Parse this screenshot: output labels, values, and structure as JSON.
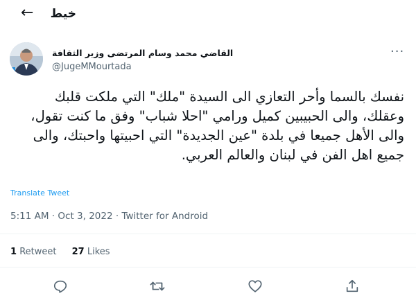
{
  "header": {
    "back_icon": "arrow-left-icon",
    "title": "خيط"
  },
  "tweet": {
    "author_name": "القاضي محمد وسام المرتضى وزير الثقافة",
    "author_handle": "@JugeMMourtada",
    "text": "نفسك بالسما وأحر التعازي الى السيدة \"ملك\" التي ملكت قلبك وعقلك، والى الحبيبين كميل ورامي \"احلا شباب\" وفق ما كنت تقول، والى الأهل جميعا في بلدة \"عين الجديدة\" التي احبيتها واحبتك، والى جميع اهل الفن في لبنان والعالم العربي.",
    "translate_label": "Translate Tweet",
    "time": "5:11 AM",
    "date": "Oct 3, 2022",
    "source": "Twitter for Android",
    "separator": "·",
    "retweet_count": "1",
    "retweet_label": "Retweet",
    "like_count": "27",
    "like_label": "Likes"
  },
  "actions": [
    {
      "icon": "reply-icon"
    },
    {
      "icon": "retweet-icon"
    },
    {
      "icon": "like-icon"
    },
    {
      "icon": "share-icon"
    }
  ],
  "colors": {
    "accent": "#1d9bf0",
    "secondary_text": "#536471",
    "divider": "#eff3f4"
  }
}
